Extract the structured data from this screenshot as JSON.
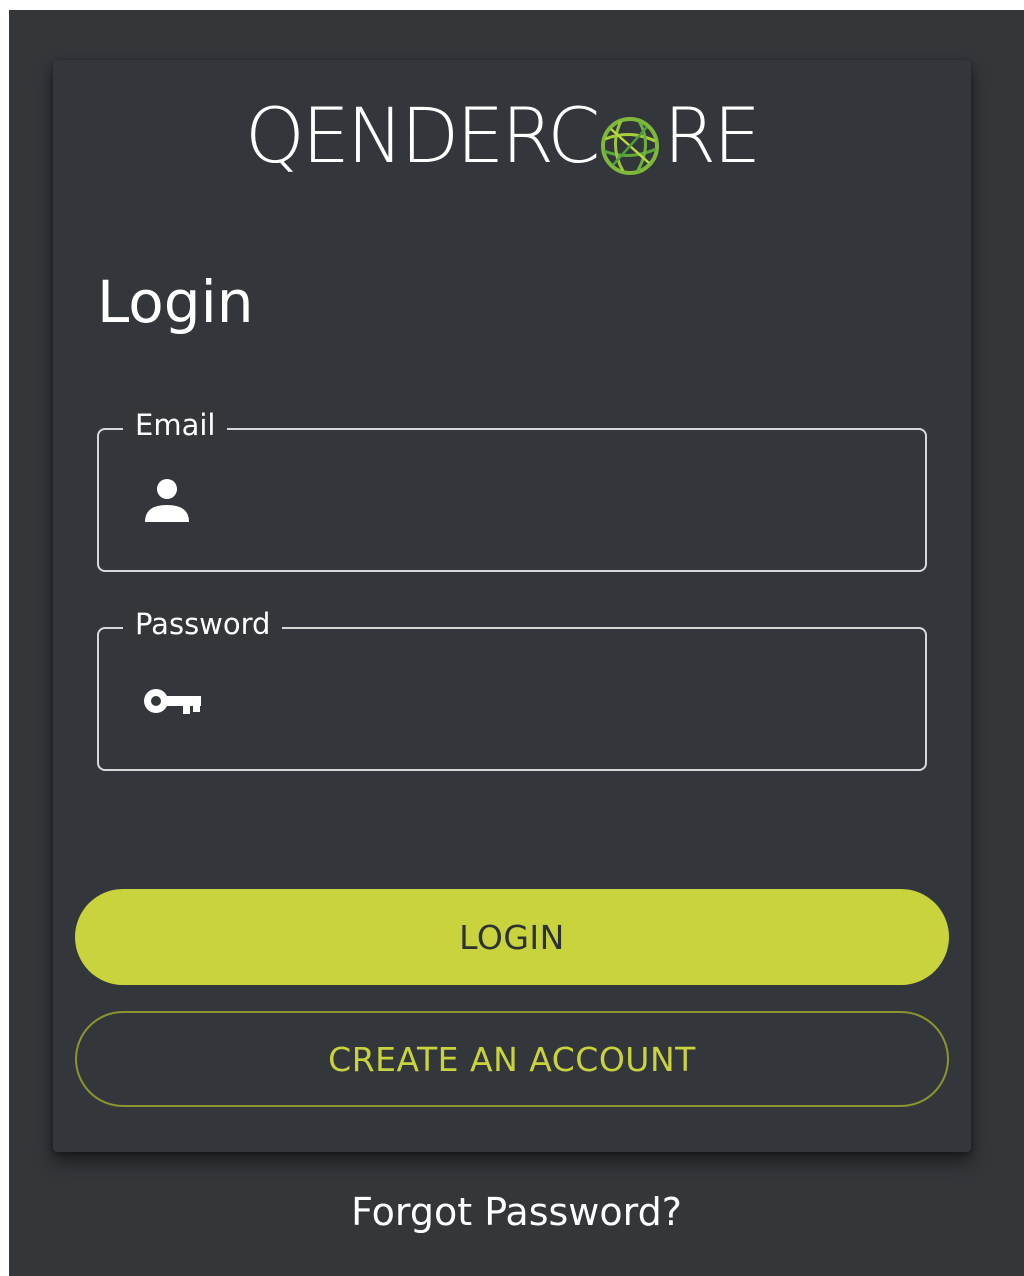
{
  "brand": {
    "logo_text_left": "QENDERC",
    "logo_text_right": "RE",
    "globe_icon": "globe-icon",
    "accent_color": "#c9d33d"
  },
  "login_form": {
    "title": "Login",
    "email": {
      "label": "Email",
      "icon": "person-icon",
      "value": "",
      "placeholder": ""
    },
    "password": {
      "label": "Password",
      "icon": "key-icon",
      "value": "",
      "placeholder": ""
    },
    "login_button_label": "LOGIN",
    "create_account_label": "CREATE AN ACCOUNT"
  },
  "forgot_password_label": "Forgot Password?"
}
